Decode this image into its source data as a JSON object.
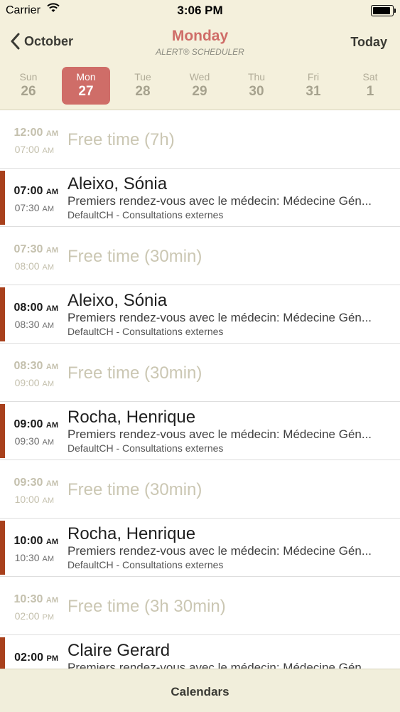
{
  "status": {
    "carrier": "Carrier",
    "time": "3:06 PM",
    "battery_level": 1.0
  },
  "nav": {
    "back_label": "October",
    "title": "Monday",
    "subtitle": "ALERT® SCHEDULER",
    "today_label": "Today"
  },
  "week": [
    {
      "name": "Sun",
      "date": "26",
      "selected": false
    },
    {
      "name": "Mon",
      "date": "27",
      "selected": true
    },
    {
      "name": "Tue",
      "date": "28",
      "selected": false
    },
    {
      "name": "Wed",
      "date": "29",
      "selected": false
    },
    {
      "name": "Thu",
      "date": "30",
      "selected": false
    },
    {
      "name": "Fri",
      "date": "31",
      "selected": false
    },
    {
      "name": "Sat",
      "date": "1",
      "selected": false
    }
  ],
  "rows": [
    {
      "type": "free",
      "start": "12:00",
      "start_ampm": "AM",
      "end": "07:00",
      "end_ampm": "AM",
      "text": "Free time (7h)"
    },
    {
      "type": "appt",
      "start": "07:00",
      "start_ampm": "AM",
      "end": "07:30",
      "end_ampm": "AM",
      "name": "Aleixo, Sónia",
      "desc": "Premiers rendez-vous avec le médecin: Médecine Gén...",
      "loc": "DefaultCH - Consultations externes"
    },
    {
      "type": "free",
      "start": "07:30",
      "start_ampm": "AM",
      "end": "08:00",
      "end_ampm": "AM",
      "text": "Free time (30min)"
    },
    {
      "type": "appt",
      "start": "08:00",
      "start_ampm": "AM",
      "end": "08:30",
      "end_ampm": "AM",
      "name": "Aleixo, Sónia",
      "desc": "Premiers rendez-vous avec le médecin: Médecine Gén...",
      "loc": "DefaultCH - Consultations externes"
    },
    {
      "type": "free",
      "start": "08:30",
      "start_ampm": "AM",
      "end": "09:00",
      "end_ampm": "AM",
      "text": "Free time (30min)"
    },
    {
      "type": "appt",
      "start": "09:00",
      "start_ampm": "AM",
      "end": "09:30",
      "end_ampm": "AM",
      "name": "Rocha, Henrique",
      "desc": "Premiers rendez-vous avec le médecin: Médecine Gén...",
      "loc": "DefaultCH - Consultations externes"
    },
    {
      "type": "free",
      "start": "09:30",
      "start_ampm": "AM",
      "end": "10:00",
      "end_ampm": "AM",
      "text": "Free time (30min)"
    },
    {
      "type": "appt",
      "start": "10:00",
      "start_ampm": "AM",
      "end": "10:30",
      "end_ampm": "AM",
      "name": "Rocha, Henrique",
      "desc": "Premiers rendez-vous avec le médecin: Médecine Gén...",
      "loc": "DefaultCH - Consultations externes"
    },
    {
      "type": "free",
      "start": "10:30",
      "start_ampm": "AM",
      "end": "02:00",
      "end_ampm": "PM",
      "text": "Free time (3h 30min)"
    },
    {
      "type": "appt",
      "start": "02:00",
      "start_ampm": "PM",
      "end": "",
      "end_ampm": "",
      "name": "Claire  Gerard",
      "desc": "Premiers rendez-vous avec le médecin: Médecine Gén...",
      "loc": ""
    }
  ],
  "footer": {
    "calendars_label": "Calendars"
  },
  "colors": {
    "accent": "#cf6d68",
    "appointment_bar": "#a8401c",
    "header_bg": "#f4f0dc"
  }
}
